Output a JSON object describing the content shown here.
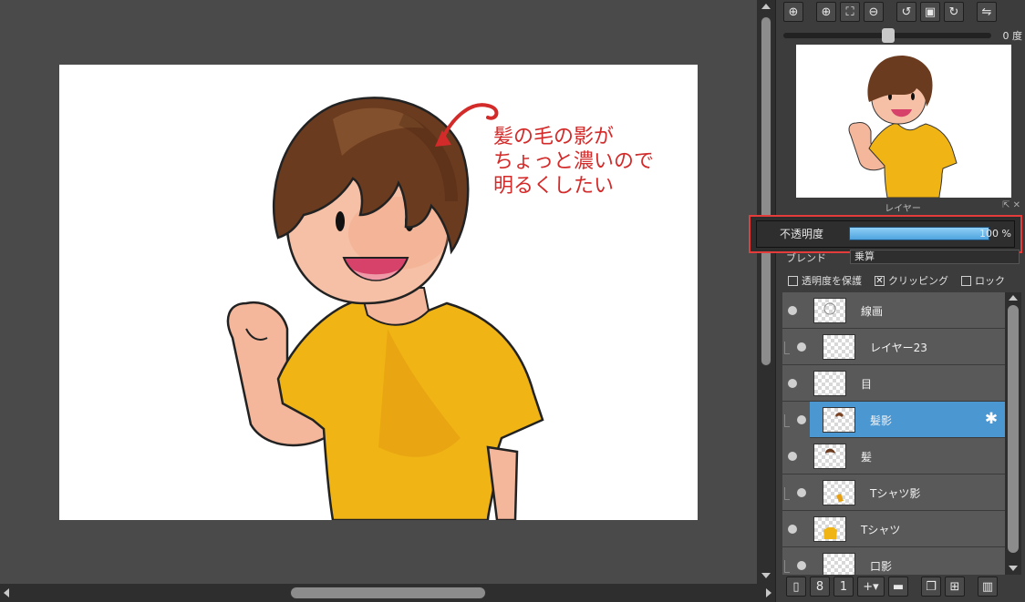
{
  "canvas": {
    "annotation_lines": [
      "髪の毛の影が",
      "ちょっと濃いので",
      "明るくしたい"
    ],
    "annotation_color": "#d32a2a"
  },
  "navigator": {
    "toolbar": [
      {
        "name": "zoom-fit-icon",
        "glyph": "⊕"
      },
      {
        "name": "zoom-in-icon",
        "glyph": "⊕"
      },
      {
        "name": "fit-screen-icon",
        "glyph": "⛶"
      },
      {
        "name": "zoom-out-icon",
        "glyph": "⊖"
      },
      {
        "name": "rotate-left-icon",
        "glyph": "↺"
      },
      {
        "name": "reset-view-icon",
        "glyph": "▣"
      },
      {
        "name": "rotate-right-icon",
        "glyph": "↻"
      },
      {
        "name": "flip-horizontal-icon",
        "glyph": "⇋"
      }
    ],
    "rotation_value": "0 度"
  },
  "layer_panel": {
    "header": "レイヤー",
    "opacity_label": "不透明度",
    "opacity_value": "100 %",
    "opacity_fraction": 1.0,
    "blend_label": "ブレンド",
    "blend_value": "乗算",
    "checks": [
      {
        "label": "透明度を保護",
        "checked": false
      },
      {
        "label": "クリッピング",
        "checked": true
      },
      {
        "label": "ロック",
        "checked": false
      }
    ],
    "layers": [
      {
        "name": "線画",
        "clip": false,
        "selected": false,
        "thumb": "lineart"
      },
      {
        "name": "レイヤー23",
        "clip": true,
        "selected": false,
        "thumb": "empty"
      },
      {
        "name": "目",
        "clip": false,
        "selected": false,
        "thumb": "empty"
      },
      {
        "name": "髪影",
        "clip": true,
        "selected": true,
        "thumb": "hairshadow"
      },
      {
        "name": "髪",
        "clip": false,
        "selected": false,
        "thumb": "hair"
      },
      {
        "name": "Tシャツ影",
        "clip": true,
        "selected": false,
        "thumb": "shirtshadow"
      },
      {
        "name": "Tシャツ",
        "clip": false,
        "selected": false,
        "thumb": "shirt"
      },
      {
        "name": "口影",
        "clip": true,
        "selected": false,
        "thumb": "empty"
      }
    ],
    "bottom_toolbar": [
      {
        "name": "new-layer-icon",
        "glyph": "🗋"
      },
      {
        "name": "new-halftone-layer-icon",
        "glyph": "8"
      },
      {
        "name": "new-1bit-layer-icon",
        "glyph": "1"
      },
      {
        "name": "add-layer-menu-icon",
        "glyph": "+"
      },
      {
        "name": "new-folder-icon",
        "glyph": "▬"
      },
      {
        "name": "duplicate-layer-icon",
        "glyph": "❐"
      },
      {
        "name": "merge-layer-icon",
        "glyph": "⊞"
      },
      {
        "name": "delete-layer-icon",
        "glyph": "🗑"
      }
    ]
  }
}
